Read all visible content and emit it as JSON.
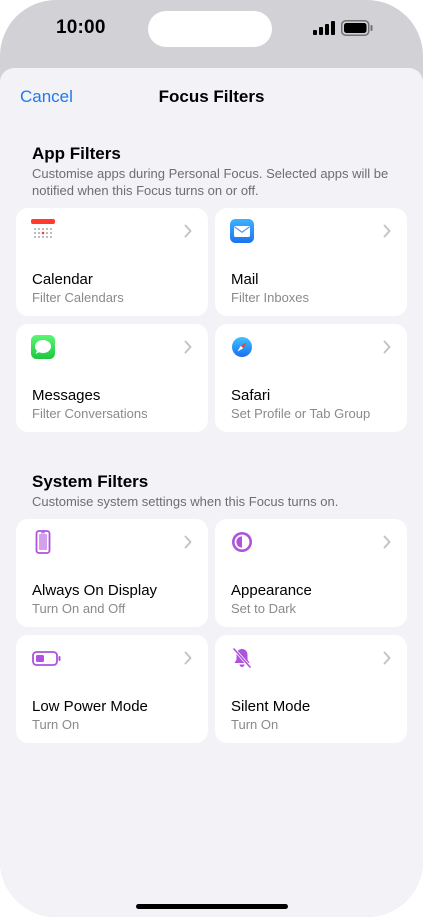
{
  "status": {
    "time": "10:00"
  },
  "nav": {
    "cancel_label": "Cancel",
    "title": "Focus Filters"
  },
  "app_filters": {
    "title": "App Filters",
    "description": "Customise apps during Personal Focus. Selected apps will be notified when this Focus turns on or off.",
    "items": [
      {
        "title": "Calendar",
        "subtitle": "Filter Calendars",
        "icon": "calendar-icon"
      },
      {
        "title": "Mail",
        "subtitle": "Filter Inboxes",
        "icon": "mail-icon"
      },
      {
        "title": "Messages",
        "subtitle": "Filter Conversations",
        "icon": "messages-icon"
      },
      {
        "title": "Safari",
        "subtitle": "Set Profile or Tab Group",
        "icon": "safari-icon"
      }
    ]
  },
  "system_filters": {
    "title": "System Filters",
    "description": "Customise system settings when this Focus turns on.",
    "items": [
      {
        "title": "Always On Display",
        "subtitle": "Turn On and Off",
        "icon": "phone-icon"
      },
      {
        "title": "Appearance",
        "subtitle": "Set to Dark",
        "icon": "appearance-icon"
      },
      {
        "title": "Low Power Mode",
        "subtitle": "Turn On",
        "icon": "battery-icon"
      },
      {
        "title": "Silent Mode",
        "subtitle": "Turn On",
        "icon": "bell-slash-icon"
      }
    ]
  },
  "colors": {
    "accent": "#1f7aeb",
    "system_icon": "#af52de",
    "sheet_bg": "#f2f2f7"
  }
}
